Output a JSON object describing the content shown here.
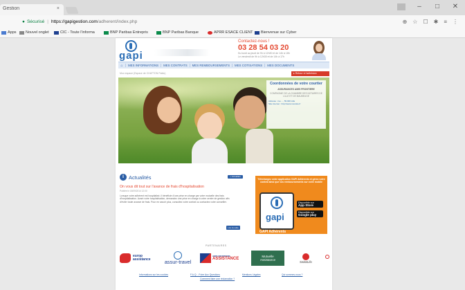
{
  "browser": {
    "tab_title": "Gestion",
    "tab_close": "×",
    "window_controls": [
      "–",
      "□",
      "✕"
    ],
    "secure_label": "Sécurisé",
    "url_host": "https://gapigestion.com",
    "url_path": "/adherent/index.php",
    "toolbar_icons": [
      "⊕",
      "☆",
      "☐",
      "✱",
      "≡",
      "⋮"
    ],
    "bookmarks": [
      {
        "label": "Apps",
        "color": "#4a7bd0"
      },
      {
        "label": "Nouvel onglet",
        "color": "#888888"
      },
      {
        "label": "CIC - Toute l'informa",
        "color": "#1d3f8f"
      },
      {
        "label": "BNP Paribas Entrepris",
        "color": "#0a8a4a"
      },
      {
        "label": "BNP Paribas Banque",
        "color": "#0a8a4a"
      },
      {
        "label": "APRR ESACE CLIENT",
        "color": "#d92b2b"
      },
      {
        "label": "Bienvenue sur Cyber",
        "color": "#1d3f8f"
      }
    ]
  },
  "header": {
    "logo_text": "gapi",
    "contact_title": "Contactez-nous !",
    "contact_phone": "03 28 54 03 20",
    "contact_hours_1": "Du lundi au jeudi de 9h à 12h30 et de 14h à 18h",
    "contact_hours_2": "Le vendredi de 9h à 12h30 et de 14h à 17h"
  },
  "nav": {
    "home_icon": "⌂",
    "items": [
      "MES INFORMATIONS",
      "MES CONTRATS",
      "MES REMBOURSEMENTS",
      "MES COTISATIONS",
      "MES DOCUMENTS"
    ]
  },
  "breadcrumb": "Mon espace (Espace de CHATTON Pablo)",
  "logout_label": "▸ Retour à l'adhésion",
  "promo": {
    "title": "Coordonnées de votre courtier",
    "subtitle": "ASSURANCES AMIS FRONTIERE",
    "text": "COMPAGNIE DE LA CHAMBRE DES NOTAIRES DE LILLE ET DE MAUBEUGE",
    "line1": "Adresse : rue ..., 59 000 Lille",
    "line2": "Site internet : http://www.monsite.fr"
  },
  "news": {
    "icon": "i",
    "title": "Actualités",
    "all_label": "+ Actualités",
    "headline": "On vous dit tout sur l'avance de frais d'hospitalisation",
    "date": "Publiée le 18/09/2014 12:00",
    "body": "Lorsque votre adhérent est hospitalisé, il bénéficie d'une prise en charge par votre mutuelle des frais d'hospitalisation. Avant votre hospitalisation, demandez une prise en charge à votre centre de gestion afin d'éviter toute avance de frais. Pour en savoir plus, consultez votre contrat ou contactez votre conseiller.",
    "more_label": "Lire la suite"
  },
  "appbox": {
    "text": "Téléchargez votre application GAPI Adhérents et gérez votre contrat ainsi que vos remboursements sur votre mobile",
    "phone_logo": "gapi",
    "appstore_small": "Disponible sur",
    "appstore_big": "App Store",
    "google_small": "Disponible sur",
    "google_big": "Google play",
    "caption": "GAPI Adhérents"
  },
  "partners": {
    "title": "PARTENAIRES",
    "europ_1": "europ",
    "europ_2": "assistance",
    "assur": "assur-travel",
    "amaf_1": "AMIS FRONTIERE",
    "amaf_2": "ASSISTANCE",
    "mutuelle_1": "Mutuelle",
    "mutuelle_2": "Assistance",
    "swiss": "SwissLife"
  },
  "footer": {
    "link1": "Informations sur les cookies",
    "link2": "F.A.Q. - Foire Aux Questions",
    "link3": "Mentions Légales",
    "link4": "Qui sommes-nous ?",
    "link5": "Comment faire une réclamation ?"
  }
}
